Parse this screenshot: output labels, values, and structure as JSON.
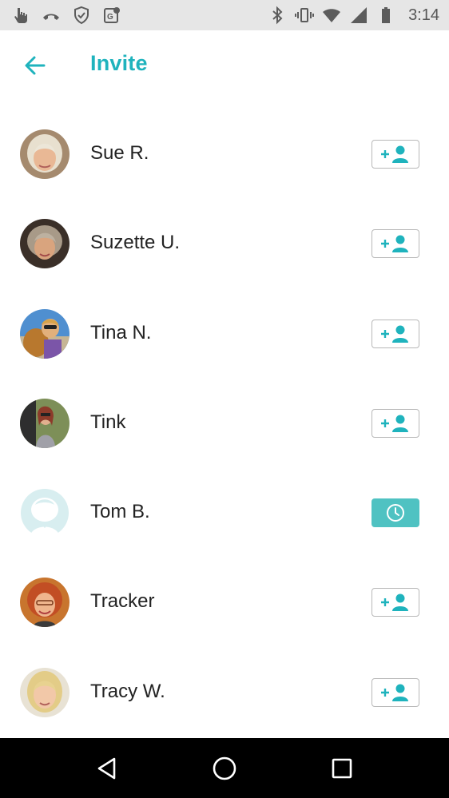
{
  "status_bar": {
    "time": "3:14",
    "icons_left": [
      "hand-icon",
      "phone-missed-icon",
      "shield-check-icon",
      "maps-icon"
    ],
    "icons_right": [
      "bluetooth-icon",
      "vibrate-icon",
      "wifi-icon",
      "cell-signal-icon",
      "battery-icon"
    ]
  },
  "header": {
    "title": "Invite",
    "back_icon": "arrow-left-icon"
  },
  "contacts": [
    {
      "name": "Sue R.",
      "status": "invite",
      "avatar_color": "#c8a27a"
    },
    {
      "name": "Suzette U.",
      "status": "invite",
      "avatar_color": "#6a5a4a"
    },
    {
      "name": "Tina N.",
      "status": "invite",
      "avatar_color": "#4e7fb0"
    },
    {
      "name": "Tink",
      "status": "invite",
      "avatar_color": "#8a9a6a"
    },
    {
      "name": "Tom B.",
      "status": "pending",
      "avatar_color": "#d8eef0"
    },
    {
      "name": "Tracker",
      "status": "invite",
      "avatar_color": "#b5652e"
    },
    {
      "name": "Tracy W.",
      "status": "invite",
      "avatar_color": "#d8c898"
    }
  ],
  "colors": {
    "accent": "#1fb3bd",
    "pending": "#4fc2c2",
    "status_bar_bg": "#e6e6e6",
    "nav_bar_bg": "#000000"
  },
  "nav_bar": {
    "buttons": [
      "back-triangle-icon",
      "home-circle-icon",
      "recents-square-icon"
    ]
  }
}
